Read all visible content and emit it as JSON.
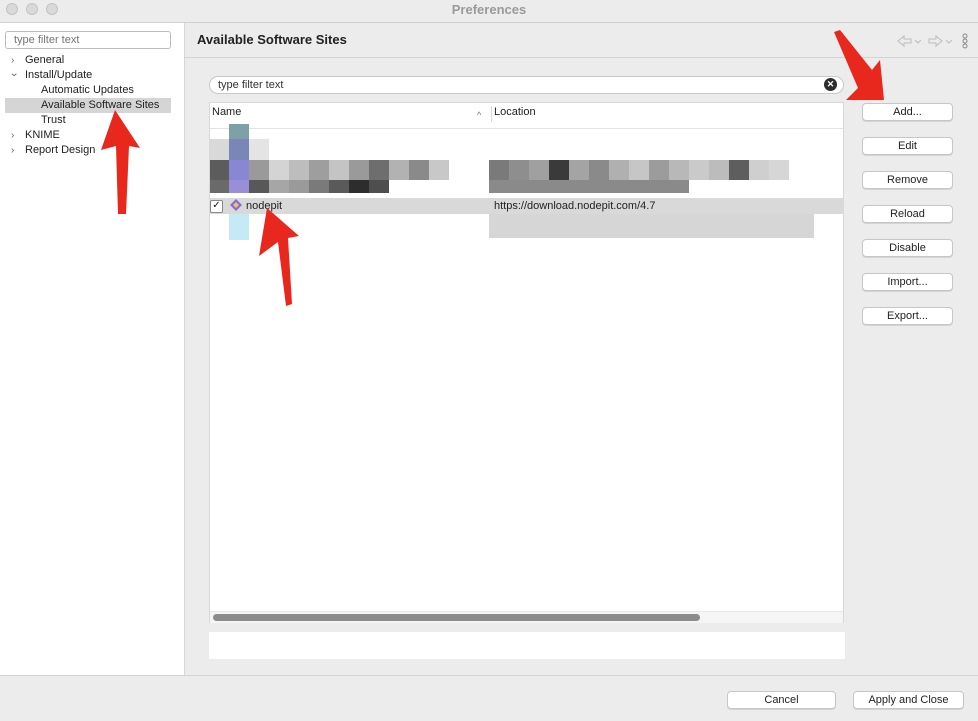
{
  "window": {
    "title": "Preferences"
  },
  "sidebar": {
    "filter_placeholder": "type filter text",
    "items": [
      {
        "label": "General",
        "expander": "›"
      },
      {
        "label": "Install/Update",
        "expander": "⌄"
      },
      {
        "label": "Automatic Updates"
      },
      {
        "label": "Available Software Sites",
        "selected": true
      },
      {
        "label": "Trust"
      },
      {
        "label": "KNIME",
        "expander": "›"
      },
      {
        "label": "Report Design",
        "expander": "›"
      }
    ]
  },
  "page": {
    "title": "Available Software Sites",
    "nav_back_icon": "back-arrow-icon",
    "nav_forward_icon": "forward-arrow-icon",
    "menu_icon": "vertical-ellipsis-icon",
    "filter_value": "type filter text"
  },
  "table": {
    "columns": [
      "Name",
      "Location"
    ],
    "rows": [
      {
        "checked": true,
        "name": "nodepit",
        "location": "https://download.nodepit.com/4.7",
        "selected": true
      }
    ]
  },
  "buttons": {
    "add": "Add...",
    "edit": "Edit",
    "remove": "Remove",
    "reload": "Reload",
    "disable": "Disable",
    "import": "Import...",
    "export": "Export..."
  },
  "footer": {
    "cancel": "Cancel",
    "apply_close": "Apply and Close"
  },
  "colors": {
    "annotation_arrow": "#e8271d",
    "selection": "#d9d9d9"
  }
}
